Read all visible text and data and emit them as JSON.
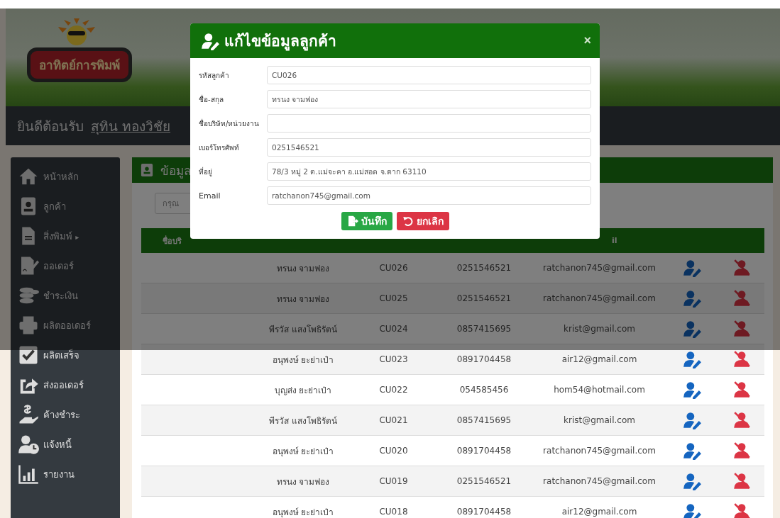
{
  "header": {
    "logo_text": "อาทิตย์การพิมพ์",
    "welcome": "ยินดีต้อนรับ",
    "user_link": "สุทิน ทองวิชัย"
  },
  "sidebar": {
    "items": [
      {
        "label": "หน้าหลัก"
      },
      {
        "label": "ลูกค้า"
      },
      {
        "label": "สิ่งพิมพ์",
        "caret": "▸"
      },
      {
        "label": "ออเดอร์"
      },
      {
        "label": "ชำระเงิน"
      },
      {
        "label": "ผลิตออเดอร์"
      },
      {
        "label": "ผลิตเสร็จ"
      },
      {
        "label": "ส่งออเดอร์"
      },
      {
        "label": "ค้างชำระ"
      },
      {
        "label": "แจ้งหนี้"
      },
      {
        "label": "รายงาน"
      }
    ]
  },
  "panel": {
    "title": "ข้อมูล",
    "search_placeholder": "กรุณ",
    "table": {
      "columns": [
        "ชื่อบริ",
        "il"
      ],
      "rows": [
        {
          "name": "ทรนง จามฟอง",
          "code": "CU026",
          "phone": "0251546521",
          "email": "ratchanon745@gmail.com"
        },
        {
          "name": "ทรนง จามฟอง",
          "code": "CU025",
          "phone": "0251546521",
          "email": "ratchanon745@gmail.com"
        },
        {
          "name": "พีรวัส แสงโพธิรัตน์",
          "code": "CU024",
          "phone": "0857415695",
          "email": "krist@gmail.com"
        },
        {
          "name": "อนุพงษ์ ยะย่าเป๋า",
          "code": "CU023",
          "phone": "0891704458",
          "email": "air12@gmail.com"
        },
        {
          "name": "บุญส่ง ยะย่าเป๋า",
          "code": "CU022",
          "phone": "054585456",
          "email": "hom54@hotmail.com"
        },
        {
          "name": "พีรวัส แสงโพธิรัตน์",
          "code": "CU021",
          "phone": "0857415695",
          "email": "krist@gmail.com"
        },
        {
          "name": "อนุพงษ์ ยะย่าเป๋า",
          "code": "CU020",
          "phone": "0891704458",
          "email": "ratchanon745@gmail.com"
        },
        {
          "name": "ทรนง จามฟอง",
          "code": "CU019",
          "phone": "0251546521",
          "email": "ratchanon745@gmail.com"
        },
        {
          "name": "อนุพงษ์ ยะย่าเป๋า",
          "code": "CU018",
          "phone": "0891704458",
          "email": "air12@gmail.com"
        }
      ]
    }
  },
  "modal": {
    "title": "แก้ไขข้อมูลลูกค้า",
    "close": "×",
    "fields": [
      {
        "label": "รหัสลูกค้า",
        "value": "CU026"
      },
      {
        "label": "ชื่อ-สกุล",
        "value": "ทรนง จามฟอง"
      },
      {
        "label": "ชื่อบริษัท/หน่วยงาน"
      },
      {
        "label": "เบอร์โทรศัพท์",
        "value": "0251546521"
      },
      {
        "label": "ที่อยู่",
        "value": "78/3 หมู่ 2 ต.แม่จะคา อ.แม่สอด จ.ตาก 63110"
      },
      {
        "label": "Email",
        "value": "ratchanon745@gmail.com"
      }
    ],
    "buttons": [
      {
        "label": "บันทึก",
        "kind": "save"
      },
      {
        "label": "ยกเลิก",
        "kind": "cancel"
      }
    ]
  }
}
